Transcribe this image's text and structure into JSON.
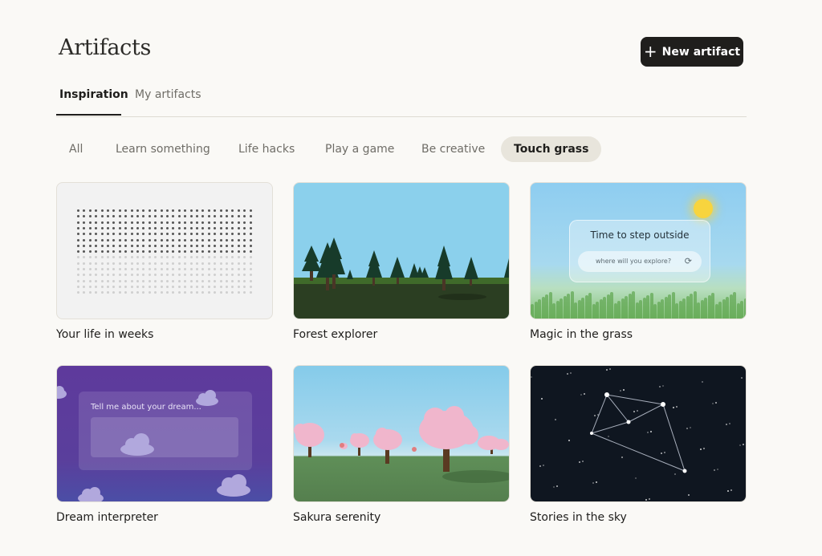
{
  "header": {
    "title": "Artifacts",
    "new_button_label": "New artifact"
  },
  "tabs": [
    {
      "label": "Inspiration",
      "active": true
    },
    {
      "label": "My artifacts",
      "active": false
    }
  ],
  "filters": [
    {
      "label": "All",
      "active": false
    },
    {
      "label": "Learn something",
      "active": false
    },
    {
      "label": "Life hacks",
      "active": false
    },
    {
      "label": "Play a game",
      "active": false
    },
    {
      "label": "Be creative",
      "active": false
    },
    {
      "label": "Touch grass",
      "active": true
    }
  ],
  "cards": [
    {
      "title": "Your life in weeks"
    },
    {
      "title": "Forest explorer"
    },
    {
      "title": "Magic in the grass",
      "preview_heading": "Time to step outside",
      "preview_placeholder": "where will you explore?"
    },
    {
      "title": "Dream interpreter",
      "preview_text": "Tell me about your dream..."
    },
    {
      "title": "Sakura serenity"
    },
    {
      "title": "Stories in the sky"
    }
  ],
  "colors": {
    "accent_button": "#1f1e1c",
    "active_chip": "#e8e5dc",
    "background": "#faf9f6"
  }
}
